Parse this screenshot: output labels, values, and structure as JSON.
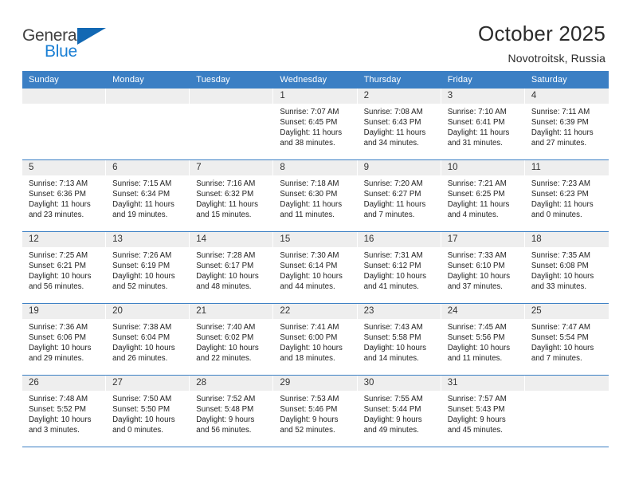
{
  "brand": {
    "name_top": "General",
    "name_bottom": "Blue",
    "flag_icon": "blue-triangle-flag-icon",
    "accent_color": "#1268b3",
    "blue_text_color": "#1a7fd4"
  },
  "header": {
    "title": "October 2025",
    "subtitle": "Novotroitsk, Russia"
  },
  "calendar": {
    "header_bg_color": "#3b7fc4",
    "day_strip_color": "#eeeeee",
    "weekday_headers": [
      "Sunday",
      "Monday",
      "Tuesday",
      "Wednesday",
      "Thursday",
      "Friday",
      "Saturday"
    ],
    "weeks": [
      [
        {
          "day": "",
          "empty": true
        },
        {
          "day": "",
          "empty": true
        },
        {
          "day": "",
          "empty": true
        },
        {
          "day": "1",
          "sunrise": "Sunrise: 7:07 AM",
          "sunset": "Sunset: 6:45 PM",
          "daylight_1": "Daylight: 11 hours",
          "daylight_2": "and 38 minutes."
        },
        {
          "day": "2",
          "sunrise": "Sunrise: 7:08 AM",
          "sunset": "Sunset: 6:43 PM",
          "daylight_1": "Daylight: 11 hours",
          "daylight_2": "and 34 minutes."
        },
        {
          "day": "3",
          "sunrise": "Sunrise: 7:10 AM",
          "sunset": "Sunset: 6:41 PM",
          "daylight_1": "Daylight: 11 hours",
          "daylight_2": "and 31 minutes."
        },
        {
          "day": "4",
          "sunrise": "Sunrise: 7:11 AM",
          "sunset": "Sunset: 6:39 PM",
          "daylight_1": "Daylight: 11 hours",
          "daylight_2": "and 27 minutes."
        }
      ],
      [
        {
          "day": "5",
          "sunrise": "Sunrise: 7:13 AM",
          "sunset": "Sunset: 6:36 PM",
          "daylight_1": "Daylight: 11 hours",
          "daylight_2": "and 23 minutes."
        },
        {
          "day": "6",
          "sunrise": "Sunrise: 7:15 AM",
          "sunset": "Sunset: 6:34 PM",
          "daylight_1": "Daylight: 11 hours",
          "daylight_2": "and 19 minutes."
        },
        {
          "day": "7",
          "sunrise": "Sunrise: 7:16 AM",
          "sunset": "Sunset: 6:32 PM",
          "daylight_1": "Daylight: 11 hours",
          "daylight_2": "and 15 minutes."
        },
        {
          "day": "8",
          "sunrise": "Sunrise: 7:18 AM",
          "sunset": "Sunset: 6:30 PM",
          "daylight_1": "Daylight: 11 hours",
          "daylight_2": "and 11 minutes."
        },
        {
          "day": "9",
          "sunrise": "Sunrise: 7:20 AM",
          "sunset": "Sunset: 6:27 PM",
          "daylight_1": "Daylight: 11 hours",
          "daylight_2": "and 7 minutes."
        },
        {
          "day": "10",
          "sunrise": "Sunrise: 7:21 AM",
          "sunset": "Sunset: 6:25 PM",
          "daylight_1": "Daylight: 11 hours",
          "daylight_2": "and 4 minutes."
        },
        {
          "day": "11",
          "sunrise": "Sunrise: 7:23 AM",
          "sunset": "Sunset: 6:23 PM",
          "daylight_1": "Daylight: 11 hours",
          "daylight_2": "and 0 minutes."
        }
      ],
      [
        {
          "day": "12",
          "sunrise": "Sunrise: 7:25 AM",
          "sunset": "Sunset: 6:21 PM",
          "daylight_1": "Daylight: 10 hours",
          "daylight_2": "and 56 minutes."
        },
        {
          "day": "13",
          "sunrise": "Sunrise: 7:26 AM",
          "sunset": "Sunset: 6:19 PM",
          "daylight_1": "Daylight: 10 hours",
          "daylight_2": "and 52 minutes."
        },
        {
          "day": "14",
          "sunrise": "Sunrise: 7:28 AM",
          "sunset": "Sunset: 6:17 PM",
          "daylight_1": "Daylight: 10 hours",
          "daylight_2": "and 48 minutes."
        },
        {
          "day": "15",
          "sunrise": "Sunrise: 7:30 AM",
          "sunset": "Sunset: 6:14 PM",
          "daylight_1": "Daylight: 10 hours",
          "daylight_2": "and 44 minutes."
        },
        {
          "day": "16",
          "sunrise": "Sunrise: 7:31 AM",
          "sunset": "Sunset: 6:12 PM",
          "daylight_1": "Daylight: 10 hours",
          "daylight_2": "and 41 minutes."
        },
        {
          "day": "17",
          "sunrise": "Sunrise: 7:33 AM",
          "sunset": "Sunset: 6:10 PM",
          "daylight_1": "Daylight: 10 hours",
          "daylight_2": "and 37 minutes."
        },
        {
          "day": "18",
          "sunrise": "Sunrise: 7:35 AM",
          "sunset": "Sunset: 6:08 PM",
          "daylight_1": "Daylight: 10 hours",
          "daylight_2": "and 33 minutes."
        }
      ],
      [
        {
          "day": "19",
          "sunrise": "Sunrise: 7:36 AM",
          "sunset": "Sunset: 6:06 PM",
          "daylight_1": "Daylight: 10 hours",
          "daylight_2": "and 29 minutes."
        },
        {
          "day": "20",
          "sunrise": "Sunrise: 7:38 AM",
          "sunset": "Sunset: 6:04 PM",
          "daylight_1": "Daylight: 10 hours",
          "daylight_2": "and 26 minutes."
        },
        {
          "day": "21",
          "sunrise": "Sunrise: 7:40 AM",
          "sunset": "Sunset: 6:02 PM",
          "daylight_1": "Daylight: 10 hours",
          "daylight_2": "and 22 minutes."
        },
        {
          "day": "22",
          "sunrise": "Sunrise: 7:41 AM",
          "sunset": "Sunset: 6:00 PM",
          "daylight_1": "Daylight: 10 hours",
          "daylight_2": "and 18 minutes."
        },
        {
          "day": "23",
          "sunrise": "Sunrise: 7:43 AM",
          "sunset": "Sunset: 5:58 PM",
          "daylight_1": "Daylight: 10 hours",
          "daylight_2": "and 14 minutes."
        },
        {
          "day": "24",
          "sunrise": "Sunrise: 7:45 AM",
          "sunset": "Sunset: 5:56 PM",
          "daylight_1": "Daylight: 10 hours",
          "daylight_2": "and 11 minutes."
        },
        {
          "day": "25",
          "sunrise": "Sunrise: 7:47 AM",
          "sunset": "Sunset: 5:54 PM",
          "daylight_1": "Daylight: 10 hours",
          "daylight_2": "and 7 minutes."
        }
      ],
      [
        {
          "day": "26",
          "sunrise": "Sunrise: 7:48 AM",
          "sunset": "Sunset: 5:52 PM",
          "daylight_1": "Daylight: 10 hours",
          "daylight_2": "and 3 minutes."
        },
        {
          "day": "27",
          "sunrise": "Sunrise: 7:50 AM",
          "sunset": "Sunset: 5:50 PM",
          "daylight_1": "Daylight: 10 hours",
          "daylight_2": "and 0 minutes."
        },
        {
          "day": "28",
          "sunrise": "Sunrise: 7:52 AM",
          "sunset": "Sunset: 5:48 PM",
          "daylight_1": "Daylight: 9 hours",
          "daylight_2": "and 56 minutes."
        },
        {
          "day": "29",
          "sunrise": "Sunrise: 7:53 AM",
          "sunset": "Sunset: 5:46 PM",
          "daylight_1": "Daylight: 9 hours",
          "daylight_2": "and 52 minutes."
        },
        {
          "day": "30",
          "sunrise": "Sunrise: 7:55 AM",
          "sunset": "Sunset: 5:44 PM",
          "daylight_1": "Daylight: 9 hours",
          "daylight_2": "and 49 minutes."
        },
        {
          "day": "31",
          "sunrise": "Sunrise: 7:57 AM",
          "sunset": "Sunset: 5:43 PM",
          "daylight_1": "Daylight: 9 hours",
          "daylight_2": "and 45 minutes."
        },
        {
          "day": "",
          "empty": true
        }
      ]
    ]
  }
}
